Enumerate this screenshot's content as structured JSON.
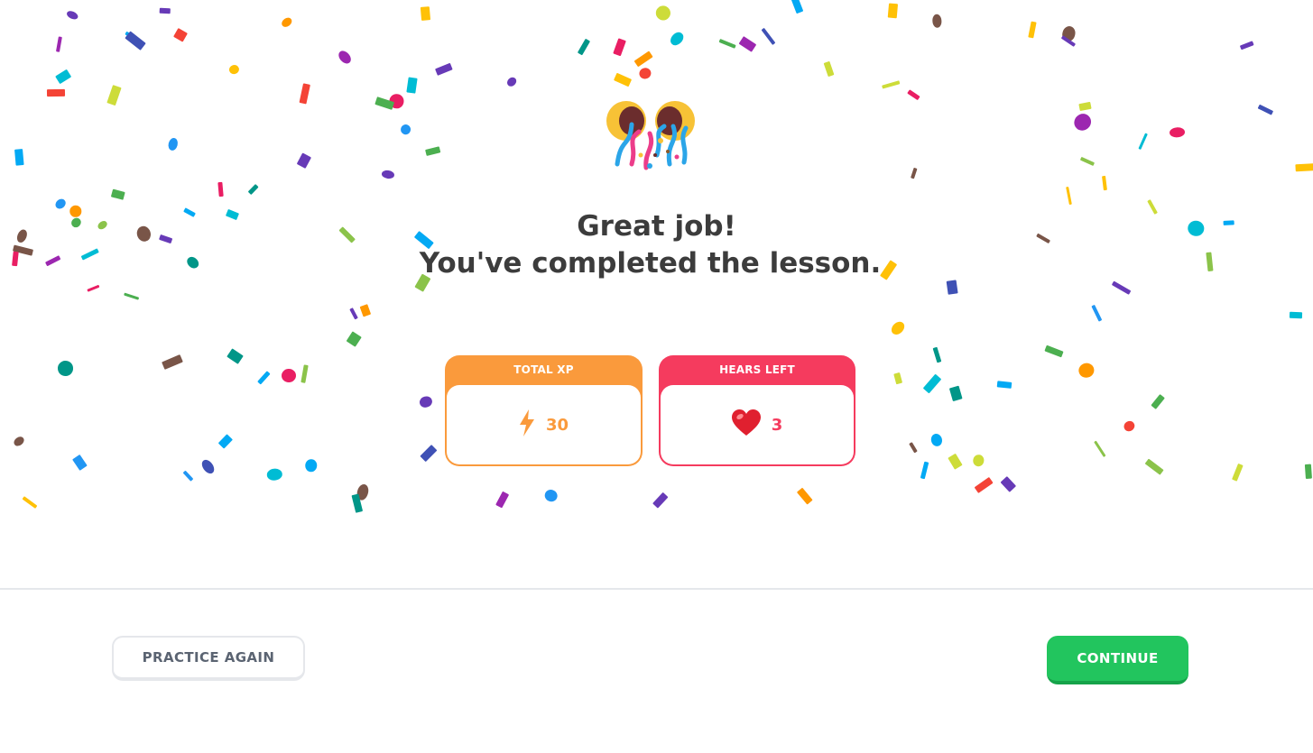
{
  "headline": {
    "line1": "Great job!",
    "line2": "You've completed the lesson."
  },
  "stats": {
    "xp": {
      "title": "TOTAL XP",
      "value": "30",
      "icon": "lightning-icon"
    },
    "hearts": {
      "title": "HEARS LEFT",
      "value": "3",
      "icon": "heart-icon"
    }
  },
  "buttons": {
    "practice_again": "PRACTICE AGAIN",
    "continue": "CONTINUE"
  },
  "colors": {
    "xp_accent": "#fa9a3c",
    "hearts_accent": "#f53b5e",
    "continue_green": "#22c55e",
    "text_dark": "#3c3c3c"
  },
  "celebration_icon": "party-popper-icon"
}
